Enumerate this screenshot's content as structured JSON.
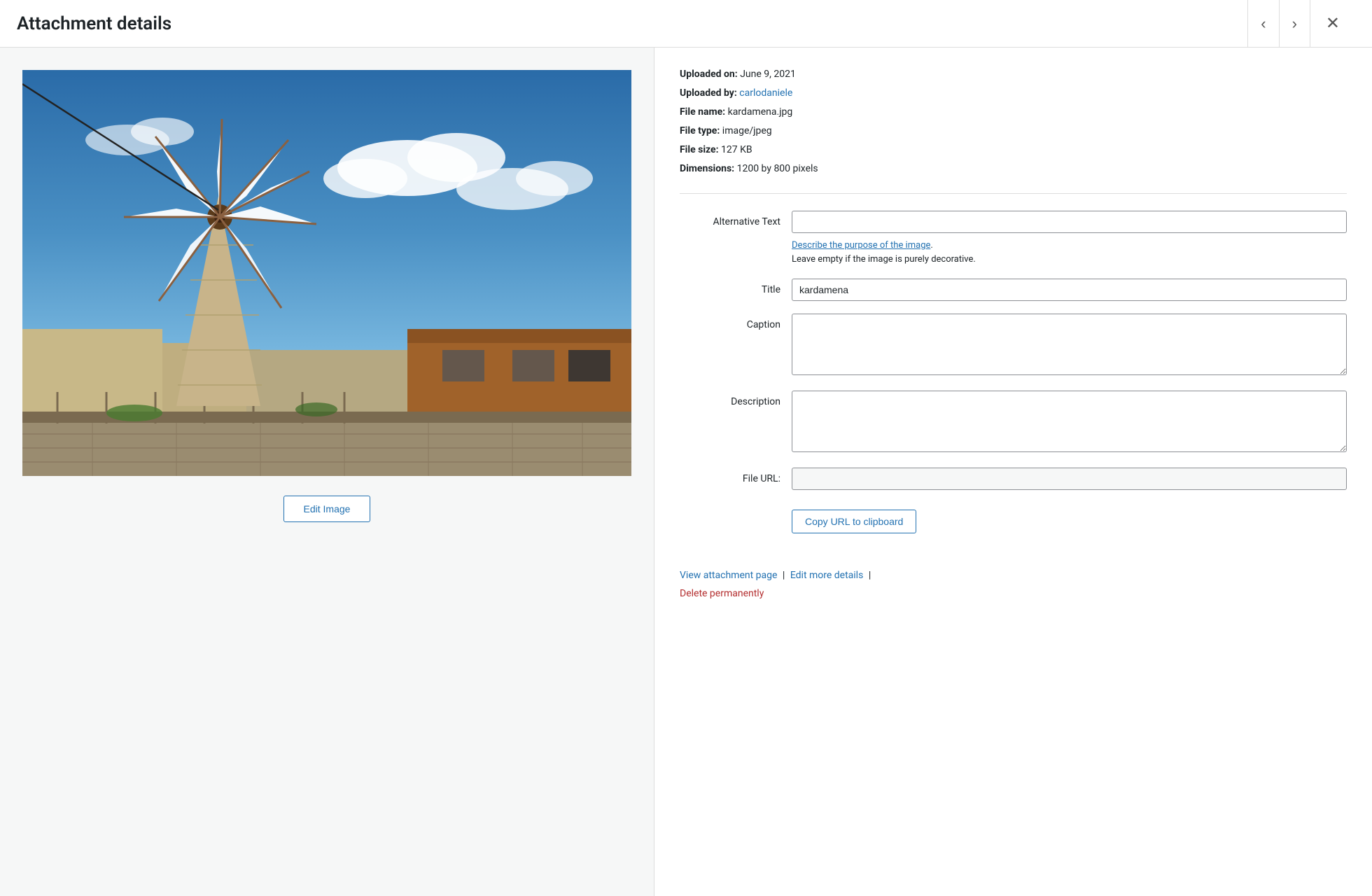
{
  "header": {
    "title": "Attachment details",
    "prev_label": "‹",
    "next_label": "›",
    "close_label": "✕"
  },
  "file_info": {
    "uploaded_on_label": "Uploaded on:",
    "uploaded_on_value": "June 9, 2021",
    "uploaded_by_label": "Uploaded by:",
    "uploaded_by_name": "carlodaniele",
    "uploaded_by_url": "#",
    "file_name_label": "File name:",
    "file_name_value": "kardamena.jpg",
    "file_type_label": "File type:",
    "file_type_value": "image/jpeg",
    "file_size_label": "File size:",
    "file_size_value": "127 KB",
    "dimensions_label": "Dimensions:",
    "dimensions_value": "1200 by 800 pixels"
  },
  "form": {
    "alt_text_label": "Alternative Text",
    "alt_text_value": "",
    "alt_text_hint_link": "Describe the purpose of the image",
    "alt_text_hint_text": "Leave empty if the image is purely decorative.",
    "title_label": "Title",
    "title_value": "kardamena",
    "caption_label": "Caption",
    "caption_value": "",
    "description_label": "Description",
    "description_value": "",
    "file_url_label": "File URL:",
    "file_url_value": "",
    "copy_url_label": "Copy URL to clipboard"
  },
  "footer": {
    "view_attachment_label": "View attachment page",
    "view_attachment_url": "#",
    "edit_more_label": "Edit more details",
    "edit_more_url": "#",
    "delete_label": "Delete permanently",
    "delete_url": "#"
  },
  "edit_image_btn": "Edit Image"
}
